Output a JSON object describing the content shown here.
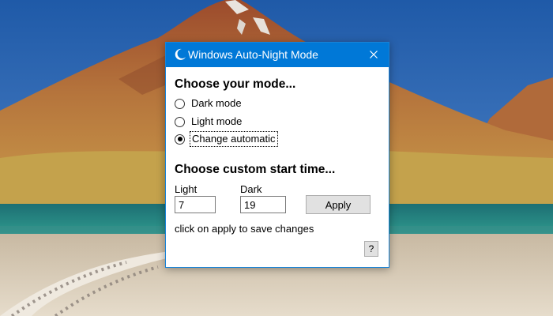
{
  "desktop": {
    "wallpaper_icon": "mountain-lake-landscape"
  },
  "window": {
    "title": "Windows Auto-Night Mode",
    "icon": "moon-icon",
    "close_icon": "close-icon",
    "accent_color": "#0078d7"
  },
  "mode_section": {
    "heading": "Choose your mode...",
    "options": [
      {
        "label": "Dark mode",
        "selected": false
      },
      {
        "label": "Light mode",
        "selected": false
      },
      {
        "label": "Change automatic",
        "selected": true
      }
    ]
  },
  "time_section": {
    "heading": "Choose custom start time...",
    "light_label": "Light",
    "light_value": "7",
    "dark_label": "Dark",
    "dark_value": "19",
    "apply_label": "Apply",
    "hint": "click on apply to save changes",
    "help_label": "?"
  }
}
